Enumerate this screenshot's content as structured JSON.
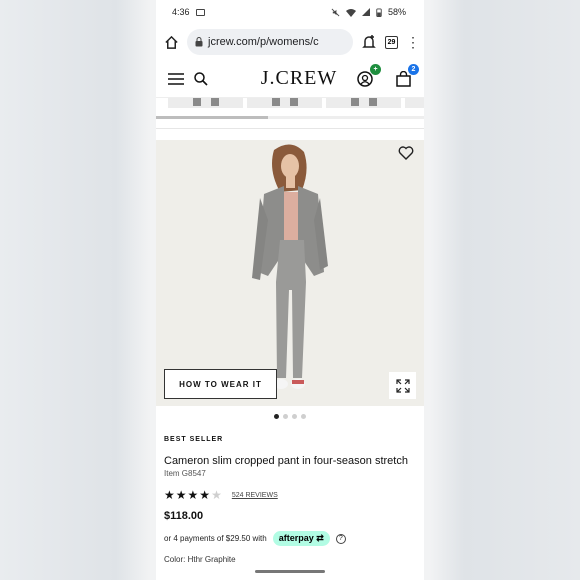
{
  "status_bar": {
    "time": "4:36",
    "battery": "58%"
  },
  "browser": {
    "url": "jcrew.com/p/womens/c",
    "tab_count": "29"
  },
  "site": {
    "brand": "J.CREW",
    "account_badge": "+",
    "cart_count": "2"
  },
  "hero": {
    "how_to_wear_label": "HOW TO WEAR IT",
    "image_count": 4,
    "active_image": 0
  },
  "product": {
    "badge": "BEST SELLER",
    "title": "Cameron slim cropped pant in four-season stretch",
    "item_number": "Item G8547",
    "rating": 4,
    "reviews": "524 REVIEWS",
    "price": "$118.00",
    "installments": "or 4 payments of $29.50 with",
    "afterpay_label": "afterpay",
    "color_label": "Color:",
    "color_value": "Hthr Graphite"
  },
  "colors": {
    "afterpay": "#b2fce4",
    "badge_green": "#1e8e3e",
    "badge_blue": "#1a73e8"
  },
  "icons": [
    "home-icon",
    "lock-icon",
    "notification-add-icon",
    "tabs-icon",
    "more-icon",
    "menu-icon",
    "search-icon",
    "account-icon",
    "bag-icon",
    "heart-icon",
    "expand-icon",
    "help-icon"
  ]
}
